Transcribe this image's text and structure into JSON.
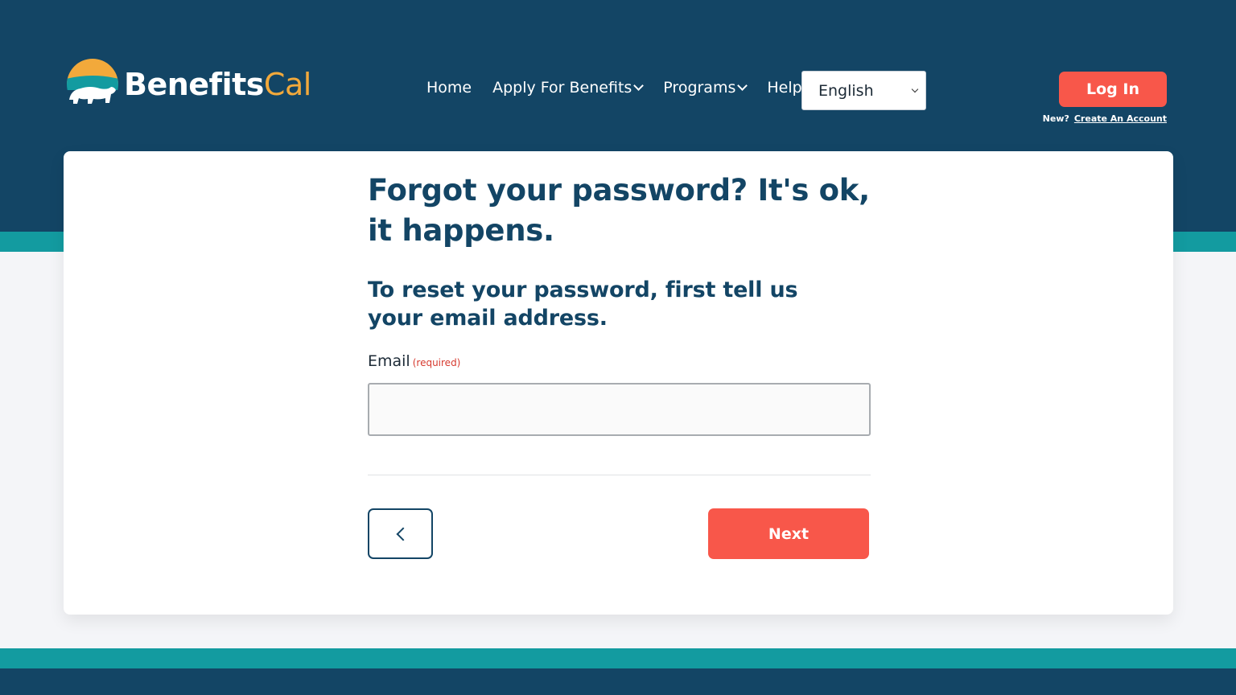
{
  "header": {
    "logo_name_part1": "Benefits",
    "logo_name_part2": "Cal",
    "nav": [
      {
        "label": "Home"
      },
      {
        "label": "Apply For Benefits"
      },
      {
        "label": "Programs"
      },
      {
        "label": "Help"
      }
    ],
    "language_selected": "English",
    "login_label": "Log In",
    "new_prefix": "New?",
    "create_account_label": "Create An Account"
  },
  "main": {
    "title": "Forgot your password? It's ok, it happens.",
    "subtitle": "To reset your password, first tell us your email address.",
    "email_label": "Email",
    "email_required": "(required)",
    "email_value": "",
    "next_label": "Next"
  },
  "colors": {
    "navy": "#134565",
    "teal": "#139ba0",
    "accent": "#f8574a",
    "logo_gold": "#f2a93b"
  },
  "icons": {
    "logo": "bear-sun-logo-icon",
    "nav_dropdown": "chevron-down-icon",
    "back": "chevron-left-icon"
  }
}
